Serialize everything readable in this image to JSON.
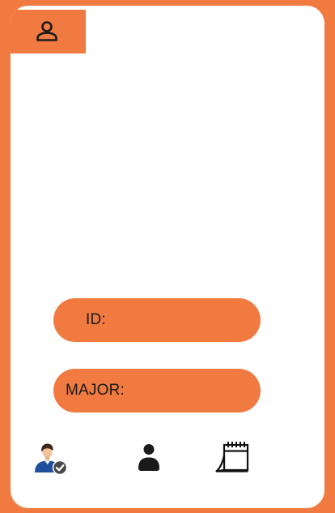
{
  "header": {
    "profile_icon": "person-outline-icon"
  },
  "fields": {
    "id_label": "ID:",
    "major_label": "MAJOR:"
  },
  "nav": {
    "items": [
      {
        "icon": "verified-user-icon"
      },
      {
        "icon": "user-icon"
      },
      {
        "icon": "calendar-icon"
      }
    ]
  },
  "colors": {
    "accent": "#F07A40",
    "surface": "#FFFFFF",
    "text": "#1A1A1A"
  }
}
